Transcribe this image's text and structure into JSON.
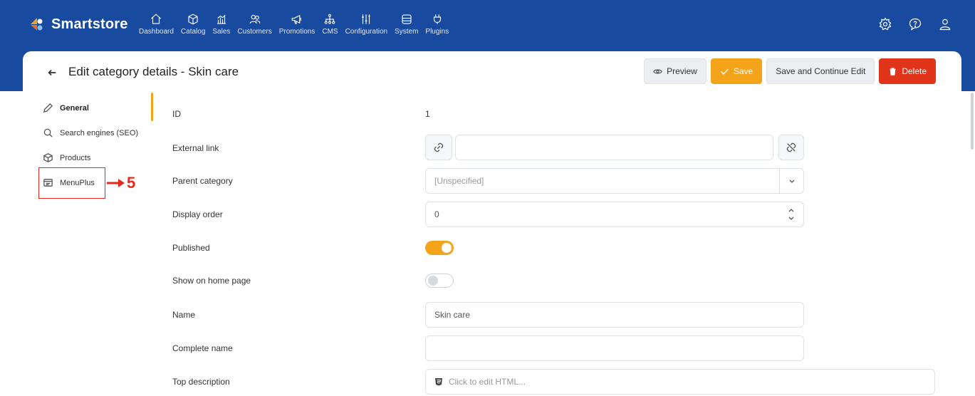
{
  "app": {
    "brand": "Smartstore"
  },
  "nav": [
    {
      "label": "Dashboard",
      "icon": "home-icon"
    },
    {
      "label": "Catalog",
      "icon": "box-icon"
    },
    {
      "label": "Sales",
      "icon": "chart-icon"
    },
    {
      "label": "Customers",
      "icon": "users-icon"
    },
    {
      "label": "Promotions",
      "icon": "megaphone-icon"
    },
    {
      "label": "CMS",
      "icon": "sitemap-icon"
    },
    {
      "label": "Configuration",
      "icon": "sliders-icon"
    },
    {
      "label": "System",
      "icon": "database-icon"
    },
    {
      "label": "Plugins",
      "icon": "plug-icon"
    }
  ],
  "top_icons": [
    "settings-icon",
    "help-icon",
    "user-icon"
  ],
  "page": {
    "title": "Edit category details - Skin care"
  },
  "actions": {
    "preview": "Preview",
    "save": "Save",
    "save_continue": "Save and Continue Edit",
    "delete": "Delete"
  },
  "sidebar": {
    "items": [
      {
        "label": "General",
        "icon": "pencil-icon",
        "active": true
      },
      {
        "label": "Search engines (SEO)",
        "icon": "search-icon",
        "active": false
      },
      {
        "label": "Products",
        "icon": "box-icon",
        "active": false
      },
      {
        "label": "MenuPlus",
        "icon": "menu-icon",
        "active": false
      }
    ]
  },
  "annotation": {
    "number": "5"
  },
  "form": {
    "id": {
      "label": "ID",
      "value": "1"
    },
    "external_link": {
      "label": "External link",
      "value": ""
    },
    "parent_category": {
      "label": "Parent category",
      "value": "[Unspecified]"
    },
    "display_order": {
      "label": "Display order",
      "value": "0"
    },
    "published": {
      "label": "Published",
      "on": true
    },
    "show_home": {
      "label": "Show on home page",
      "on": false
    },
    "name": {
      "label": "Name",
      "value": "Skin care"
    },
    "complete_name": {
      "label": "Complete name",
      "value": ""
    },
    "top_description": {
      "label": "Top description",
      "placeholder": "Click to edit HTML..."
    }
  },
  "colors": {
    "header": "#184aa0",
    "accent": "#f3a41b",
    "danger": "#e0341b"
  }
}
